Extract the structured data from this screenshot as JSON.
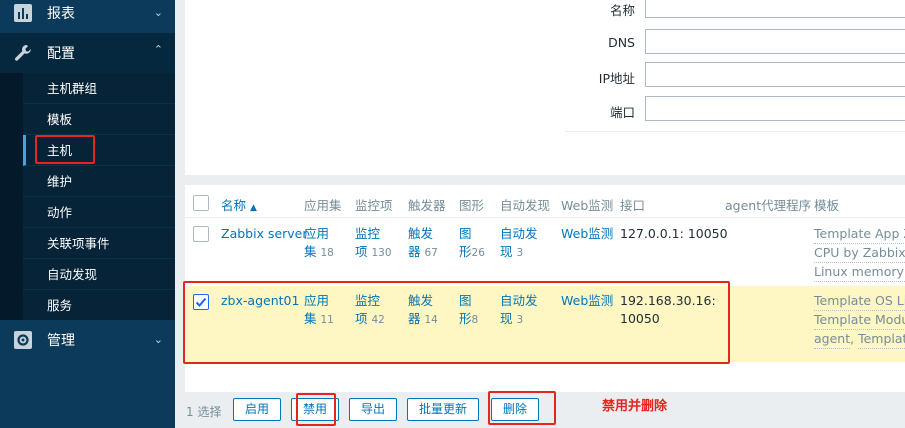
{
  "sidebar": {
    "reports": {
      "label": "报表",
      "icon": "bar-chart-icon"
    },
    "config": {
      "label": "配置",
      "icon": "wrench-icon"
    },
    "admin": {
      "label": "管理",
      "icon": "gear-icon"
    },
    "items": [
      "主机群组",
      "模板",
      "主机",
      "维护",
      "动作",
      "关联项事件",
      "自动发现",
      "服务"
    ],
    "active_item": "主机"
  },
  "filter": {
    "name_label": "名称",
    "dns_label": "DNS",
    "ip_label": "IP地址",
    "port_label": "端口"
  },
  "table": {
    "headers": {
      "name": "名称",
      "sort_indicator": "▲",
      "apps": "应用集",
      "items": "监控项",
      "triggers": "触发器",
      "graphs": "图形",
      "discovery": "自动发现",
      "web": "Web监测",
      "interface": "接口",
      "proxy": "agent代理程序",
      "templates": "模板"
    },
    "rows": [
      {
        "name": "Zabbix server",
        "apps_a": "应用",
        "apps_b": "集",
        "apps_count": "18",
        "items_a": "监控",
        "items_b": "项",
        "items_count": "130",
        "triggers_a": "触发",
        "triggers_b": "器",
        "triggers_count": "67",
        "graphs_a": "图",
        "graphs_b": "形",
        "graphs_count": "26",
        "disc_a": "自动发",
        "disc_b": "现",
        "disc_count": "3",
        "web": "Web监测",
        "interface": "127.0.0.1: 10050",
        "templates": [
          "Template App Za",
          "CPU by Zabbix a",
          "Linux memory by"
        ]
      },
      {
        "name": "zbx-agent01",
        "apps_a": "应用",
        "apps_b": "集",
        "apps_count": "11",
        "items_a": "监控",
        "items_b": "项",
        "items_count": "42",
        "triggers_a": "触发",
        "triggers_b": "器",
        "triggers_count": "14",
        "graphs_a": "图",
        "graphs_b": "形",
        "graphs_count": "8",
        "disc_a": "自动发",
        "disc_b": "现",
        "disc_count": "3",
        "web": "Web监测",
        "interface_a": "192.168.30.16:",
        "interface_b": "10050",
        "templates": [
          "Template OS Lin",
          "Template Module",
          "agent",
          "Template"
        ],
        "selected": true
      }
    ]
  },
  "actions": {
    "selected_count": "1 选择",
    "enable": "启用",
    "disable": "禁用",
    "export": "导出",
    "mass_update": "批量更新",
    "delete": "删除"
  },
  "annotation": "禁用并删除",
  "colors": {
    "sidebar_bg": "#0b3a5a",
    "link": "#0275b8",
    "selected_row": "#fef7c4",
    "annotation_red": "#e3261f"
  }
}
